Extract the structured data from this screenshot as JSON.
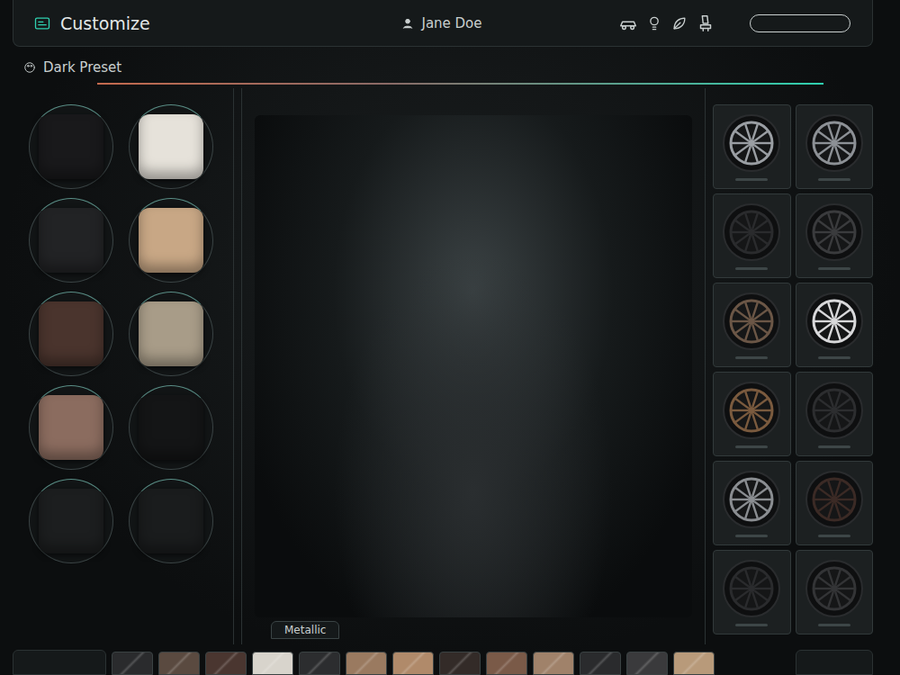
{
  "header": {
    "title": "Customize",
    "user": "Jane Doe"
  },
  "preset": {
    "label": "Dark Preset"
  },
  "swatches": [
    {
      "color": "#19191b"
    },
    {
      "color": "#e6e2da"
    },
    {
      "color": "#222325"
    },
    {
      "color": "#c8a785"
    },
    {
      "color": "#4a342d"
    },
    {
      "color": "#a89c88"
    },
    {
      "color": "#8b6c5f"
    },
    {
      "color": "#141516"
    },
    {
      "color": "#1c1e1f"
    },
    {
      "color": "#1a1c1d"
    }
  ],
  "viewport": {
    "finish": "Metallic"
  },
  "wheels": [
    {
      "color": "#9a9ea3"
    },
    {
      "color": "#8c9095"
    },
    {
      "color": "#2a2b2d"
    },
    {
      "color": "#3a3b3d"
    },
    {
      "color": "#6b5646"
    },
    {
      "color": "#d8d8da"
    },
    {
      "color": "#7a5a3e"
    },
    {
      "color": "#2c2d2f"
    },
    {
      "color": "#8a8d91"
    },
    {
      "color": "#3b2a25"
    },
    {
      "color": "#2a2b2d"
    },
    {
      "color": "#333436"
    }
  ],
  "strip": [
    {
      "color": "#2a2b2d"
    },
    {
      "color": "#5a4a40"
    },
    {
      "color": "#4a3630"
    },
    {
      "color": "#d8d4cc"
    },
    {
      "color": "#2c2d2f"
    },
    {
      "color": "#9a7a60"
    },
    {
      "color": "#b08a6a"
    },
    {
      "color": "#332b28"
    },
    {
      "color": "#7a5a48"
    },
    {
      "color": "#a0826a"
    },
    {
      "color": "#2a2b2d"
    },
    {
      "color": "#3a3a3c"
    },
    {
      "color": "#b89a7a"
    }
  ]
}
